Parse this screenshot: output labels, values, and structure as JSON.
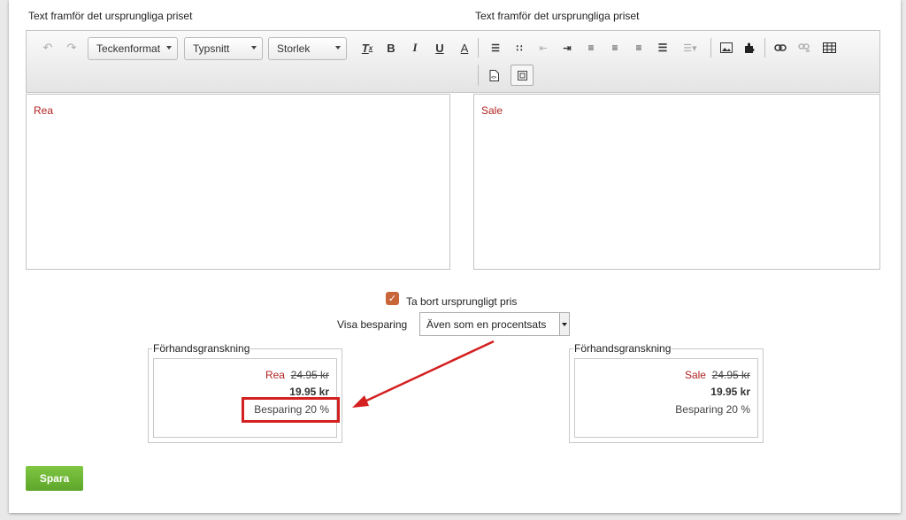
{
  "labels": {
    "left_heading": "Text framför det ursprungliga priset",
    "right_heading": "Text framför det ursprungliga priset"
  },
  "toolbar": {
    "format_combo": "Teckenformat",
    "font_combo": "Typsnitt",
    "size_combo": "Storlek"
  },
  "editors": {
    "left_content": "Rea",
    "right_content": "Sale"
  },
  "options": {
    "remove_original_label": "Ta bort ursprungligt pris",
    "remove_original_checked": true,
    "show_saving_label": "Visa besparing",
    "show_saving_value": "Även som en procentsats"
  },
  "preview_left": {
    "legend": "Förhandsgranskning",
    "prefix": "Rea",
    "original_price": "24.95 kr",
    "new_price": "19.95 kr",
    "saving": "Besparing 20 %"
  },
  "preview_right": {
    "legend": "Förhandsgranskning",
    "prefix": "Sale",
    "original_price": "24.95 kr",
    "new_price": "19.95 kr",
    "saving": "Besparing 20 %"
  },
  "actions": {
    "save_label": "Spara"
  },
  "colors": {
    "accent_red": "#b22222",
    "annotation_red": "#d42020",
    "save_green": "#6bb333",
    "checkbox_orange": "#c8663a"
  }
}
